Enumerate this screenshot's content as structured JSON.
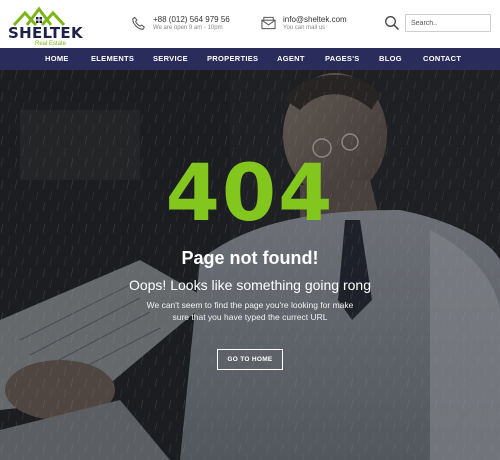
{
  "brand": {
    "name": "SHELTEK",
    "tagline": "Real Estate",
    "accent": "#7cb518",
    "navy": "#2a2d5b"
  },
  "contact": {
    "phone": {
      "icon": "phone-icon",
      "number": "+88 (012) 564 979 56",
      "hours": "We are open 9 am - 10pm"
    },
    "email": {
      "icon": "mail-icon",
      "address": "info@sheltek.com",
      "note": "You can mail us"
    }
  },
  "search": {
    "placeholder": "Search..",
    "icon": "search-icon"
  },
  "nav": [
    "HOME",
    "ELEMENTS",
    "SERVICE",
    "PROPERTIES",
    "AGENT",
    "PAGES'S",
    "BLOG",
    "CONTACT"
  ],
  "error": {
    "code": "404",
    "title": "Page not found!",
    "subtitle": "Oops! Looks like something going rong",
    "description": "We can't seem to find the page you're looking for make sure that you have typed the currect URL",
    "button": "GO TO HOME"
  }
}
